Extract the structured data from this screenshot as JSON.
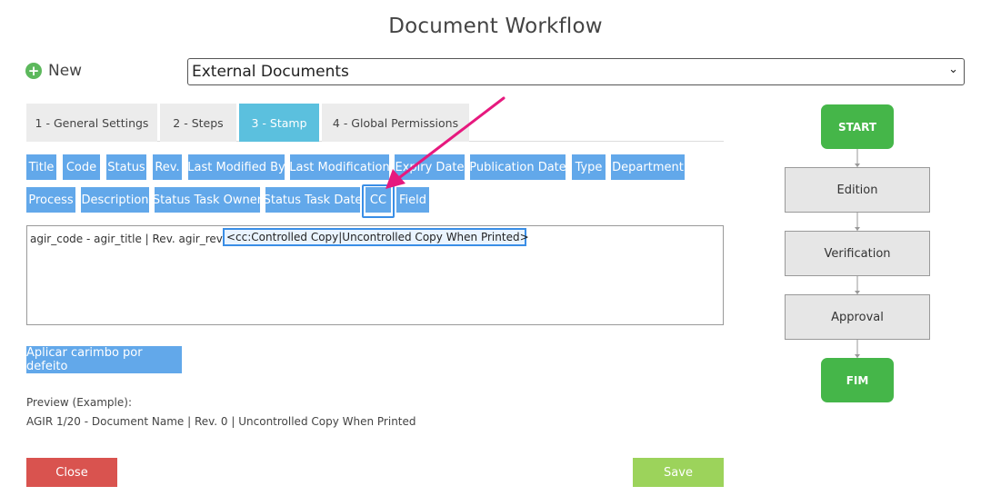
{
  "page": {
    "title": "Document Workflow"
  },
  "new_action": {
    "label": "New",
    "icon": "plus-circle-icon"
  },
  "document_type_select": {
    "value": "External Documents"
  },
  "tabs": [
    {
      "label": "1 - General Settings",
      "active": false
    },
    {
      "label": "2 - Steps",
      "active": false
    },
    {
      "label": "3 - Stamp",
      "active": true
    },
    {
      "label": "4 - Global Permissions",
      "active": false
    }
  ],
  "fields_row1": [
    "Title",
    "Code",
    "Status",
    "Rev.",
    "Last Modified By",
    "Last Modification",
    "Expiry Date",
    "Publication Date",
    "Type",
    "Department"
  ],
  "fields_row2": [
    "Process",
    "Description",
    "Status Task Owner",
    "Status Task Date",
    "CC",
    "Field"
  ],
  "stamp_editor": {
    "text": "agir_code - agir_title | Rev. agir_rev |",
    "highlighted_tag": "<cc:Controlled Copy|Uncontrolled Copy When Printed>"
  },
  "apply_default_button": "Aplicar carimbo por defeito",
  "preview": {
    "label": "Preview (Example):",
    "value": "AGIR 1/20 - Document Name | Rev. 0 | Uncontrolled Copy When Printed"
  },
  "buttons": {
    "close": "Close",
    "save": "Save"
  },
  "workflow": {
    "start": "START",
    "steps": [
      "Edition",
      "Verification",
      "Approval"
    ],
    "end": "FIM"
  },
  "colors": {
    "tab_active": "#5bc0de",
    "field_button": "#62a8ea",
    "close_button": "#d9534f",
    "save_button": "#9cd35b",
    "flow_terminal": "#45b649",
    "annotation_arrow": "#e6197e"
  }
}
